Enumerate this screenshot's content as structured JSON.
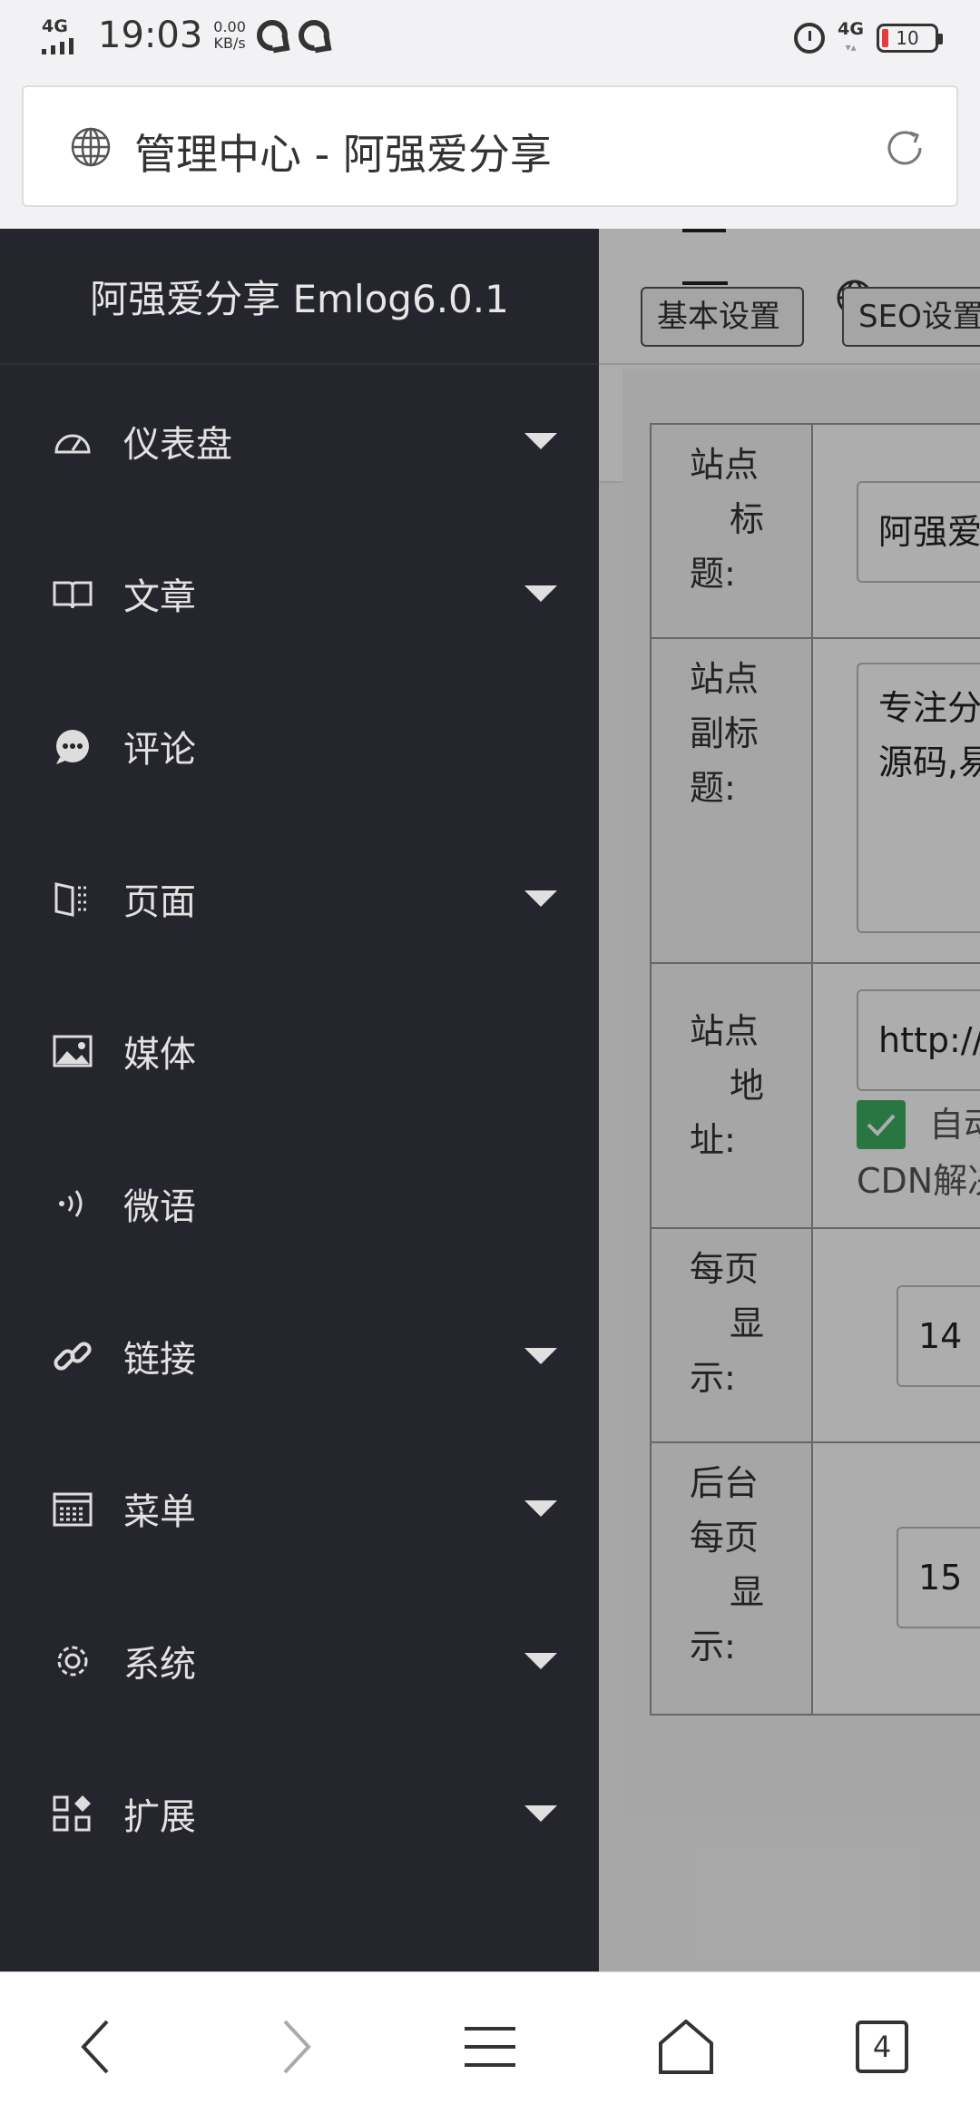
{
  "status_bar": {
    "network_tag": "4G",
    "time": "19:03",
    "speed_value": "0.00",
    "speed_unit": "KB/s",
    "right_network": "4G",
    "battery": "10",
    "battery_color": "#e23c3c"
  },
  "browser": {
    "page_title": "管理中心 - 阿强爱分享"
  },
  "app": {
    "brand": "阿强爱分享 Emlog6.0.1",
    "sidebar_bg": "#25252d"
  },
  "sidebar": {
    "items": [
      {
        "label": "仪表盘",
        "icon": "dashboard-icon",
        "has_submenu": true
      },
      {
        "label": "文章",
        "icon": "book-icon",
        "has_submenu": true
      },
      {
        "label": "评论",
        "icon": "comment-icon",
        "has_submenu": false
      },
      {
        "label": "页面",
        "icon": "page-icon",
        "has_submenu": true
      },
      {
        "label": "媒体",
        "icon": "image-icon",
        "has_submenu": false
      },
      {
        "label": "微语",
        "icon": "broadcast-icon",
        "has_submenu": false
      },
      {
        "label": "链接",
        "icon": "link-icon",
        "has_submenu": true
      },
      {
        "label": "菜单",
        "icon": "calendar-icon",
        "has_submenu": true
      },
      {
        "label": "系统",
        "icon": "gear-icon",
        "has_submenu": true
      },
      {
        "label": "扩展",
        "icon": "apps-icon",
        "has_submenu": true
      }
    ]
  },
  "settings": {
    "tabs": [
      "基本设置",
      "SEO设置"
    ],
    "site_title": {
      "label_lines": [
        "站点",
        "标",
        "题:"
      ],
      "value": "阿强爱"
    },
    "site_subtitle": {
      "label_lines": [
        "站点",
        "副标",
        "题:"
      ],
      "value_lines": [
        "专注分",
        "源码,易"
      ]
    },
    "site_url": {
      "label_lines": [
        "站点",
        "地",
        "址:"
      ],
      "value": "http://",
      "checkbox_text": "自动",
      "extra_text": "CDN解决",
      "checkbox_color": "#3fae62"
    },
    "per_page": {
      "label_lines": [
        "每页",
        "显",
        "示:"
      ],
      "value": "14"
    },
    "admin_per_page": {
      "label_lines": [
        "后台",
        "每页",
        "显",
        "示:"
      ],
      "value": "15"
    }
  },
  "bottom_nav": {
    "tab_count": "4"
  }
}
